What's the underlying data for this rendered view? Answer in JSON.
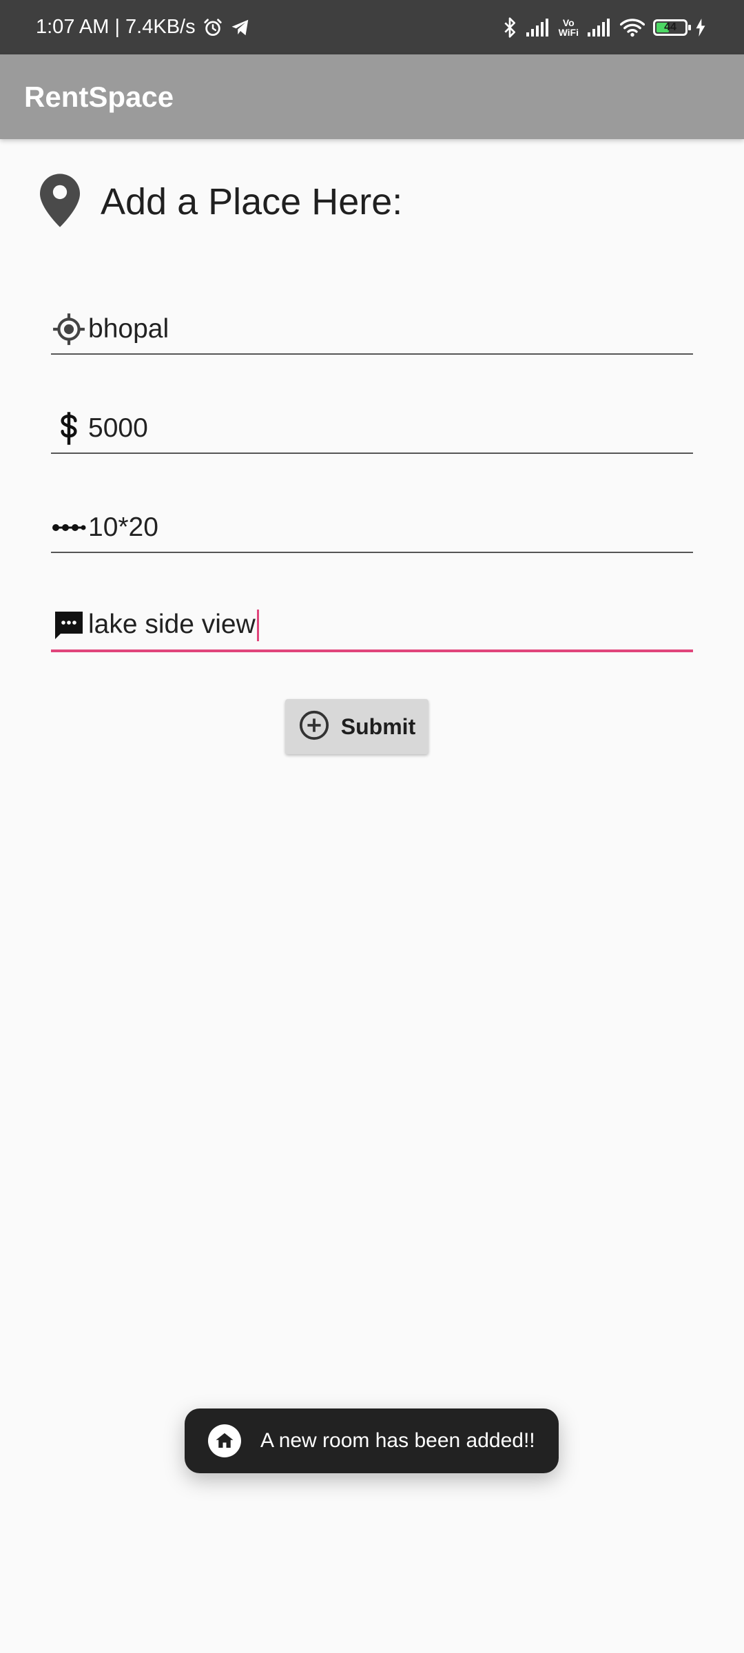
{
  "status_bar": {
    "time_speed": "1:07 AM | 7.4KB/s",
    "vowifi_top": "Vo",
    "vowifi_bottom": "WiFi",
    "battery_level": "44",
    "battery_fraction": 0.44
  },
  "app_bar": {
    "title": "RentSpace"
  },
  "form": {
    "heading": "Add a Place Here:",
    "location_value": "bhopal",
    "price_value": "5000",
    "size_value": "10*20",
    "description_value": "lake side view",
    "submit_label": "Submit"
  },
  "toast": {
    "message": "A new room has been added!!"
  },
  "colors": {
    "status_bar": "#3f3f3f",
    "app_bar": "#9b9b9b",
    "accent": "#e0457b",
    "background": "#fafafa",
    "toast": "#222222"
  }
}
